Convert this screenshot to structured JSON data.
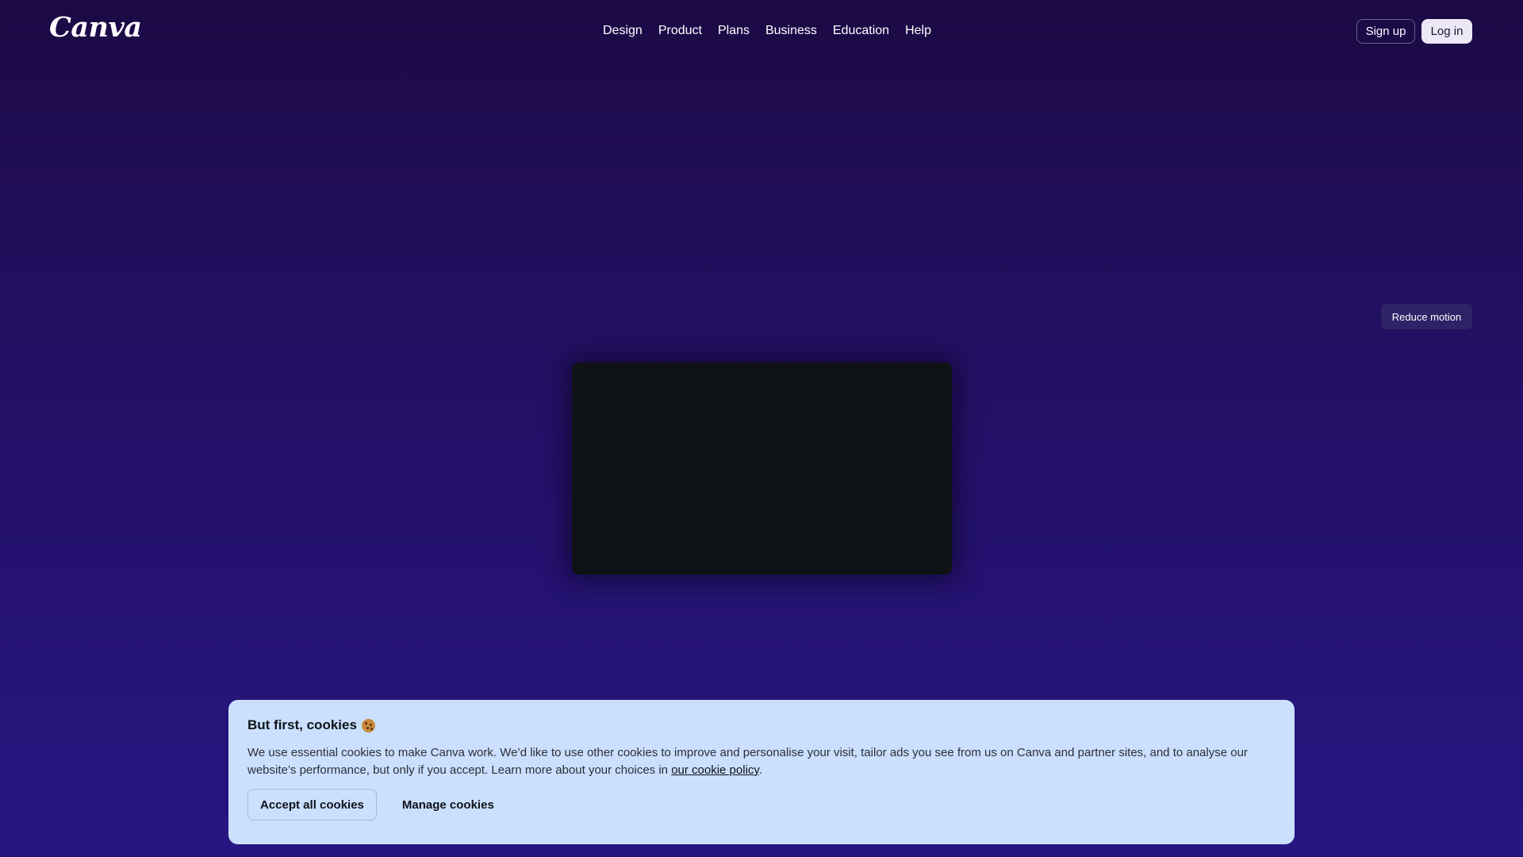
{
  "header": {
    "logo": "Canva",
    "nav": [
      "Design",
      "Product",
      "Plans",
      "Business",
      "Education",
      "Help"
    ],
    "signup_label": "Sign up",
    "login_label": "Log in"
  },
  "hero": {
    "reduce_motion_label": "Reduce motion"
  },
  "cookie_banner": {
    "title": "But first, cookies",
    "title_icon": "cookie-icon",
    "text_before_link": "We use essential cookies to make Canva work. We’d like to use other cookies to improve and personalise your visit, tailor ads you see from us on Canva and partner sites, and to analyse our website’s performance, but only if you accept. Learn more about your choices in ",
    "link_label": "our cookie policy",
    "text_after_link": ".",
    "accept_label": "Accept all cookies",
    "manage_label": "Manage cookies"
  },
  "colors": {
    "background_top": "#1c0a45",
    "background_bottom": "#271582",
    "banner_background": "#cbdfff",
    "video_frame": "#0f1216"
  }
}
